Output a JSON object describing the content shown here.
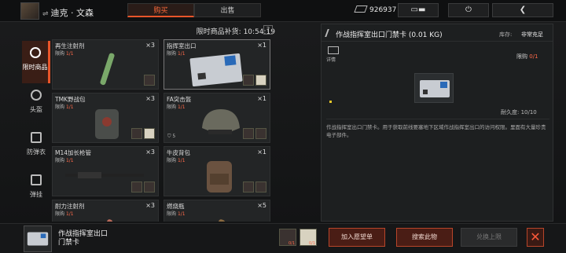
{
  "header": {
    "player_name": "迪克 · 文森",
    "tabs": [
      {
        "label": "购买",
        "active": true
      },
      {
        "label": "出售",
        "active": false
      }
    ],
    "currency": "926937",
    "power_icon": "power-icon",
    "back_icon": "back-icon"
  },
  "categories": [
    {
      "label": "限时商品",
      "icon": "clock-icon",
      "active": true
    },
    {
      "label": "头盔",
      "icon": "helmet-icon",
      "active": false
    },
    {
      "label": "防弹衣",
      "icon": "vest-icon",
      "active": false
    },
    {
      "label": "弹挂",
      "icon": "rig-icon",
      "active": false
    }
  ],
  "restock": {
    "label": "限时商品补货: 10:54:19",
    "help": "?"
  },
  "items": [
    {
      "name": "再生注射剂",
      "limit_label": "限购",
      "limit": "1/1",
      "qty": "×3",
      "icon": "syringe-icon"
    },
    {
      "name": "指挥室出口",
      "limit_label": "限购",
      "limit": "1/1",
      "qty": "×1",
      "icon": "keycard-icon",
      "selected": true
    },
    {
      "name": "TMK野战包",
      "limit_label": "限购",
      "limit": "1/1",
      "qty": "×3",
      "icon": "medkit-icon"
    },
    {
      "name": "FA突击盔",
      "limit_label": "限购",
      "limit": "1/1",
      "qty": "×1",
      "icon": "helmet-icon",
      "durability": "5"
    },
    {
      "name": "M14加长枪管",
      "limit_label": "限购",
      "limit": "1/1",
      "qty": "×3",
      "icon": "barrel-icon"
    },
    {
      "name": "牛皮背包",
      "limit_label": "限购",
      "limit": "1/1",
      "qty": "×1",
      "icon": "backpack-icon"
    },
    {
      "name": "耐力注射剂",
      "limit_label": "限购",
      "limit": "1/1",
      "qty": "×3",
      "icon": "syringe-icon"
    },
    {
      "name": "燃烧瓶",
      "limit_label": "限购",
      "limit": "1/1",
      "qty": "×5",
      "icon": "molotov-icon"
    }
  ],
  "detail": {
    "title": "作战指挥室出口门禁卡 (0.01 KG)",
    "stock_label": "库存:",
    "stock_value": "非常充足",
    "info_label": "详情",
    "purchase_label": "限购",
    "purchase_value": "0/1",
    "durability": "耐久度: 10/10",
    "description": "作战指挥室出口门禁卡。用于获取前线要塞地下区域作战指挥室出口的访问权限。里面有大量珍贵电子部件。"
  },
  "bottom": {
    "item_name": "作战指挥室出口门禁卡",
    "cost": [
      {
        "count": "0/1"
      },
      {
        "count": "0/1"
      }
    ],
    "buttons": {
      "wishlist": "加入愿望单",
      "search": "搜索此物",
      "exchange": "兑换上限"
    },
    "close": "✕"
  }
}
